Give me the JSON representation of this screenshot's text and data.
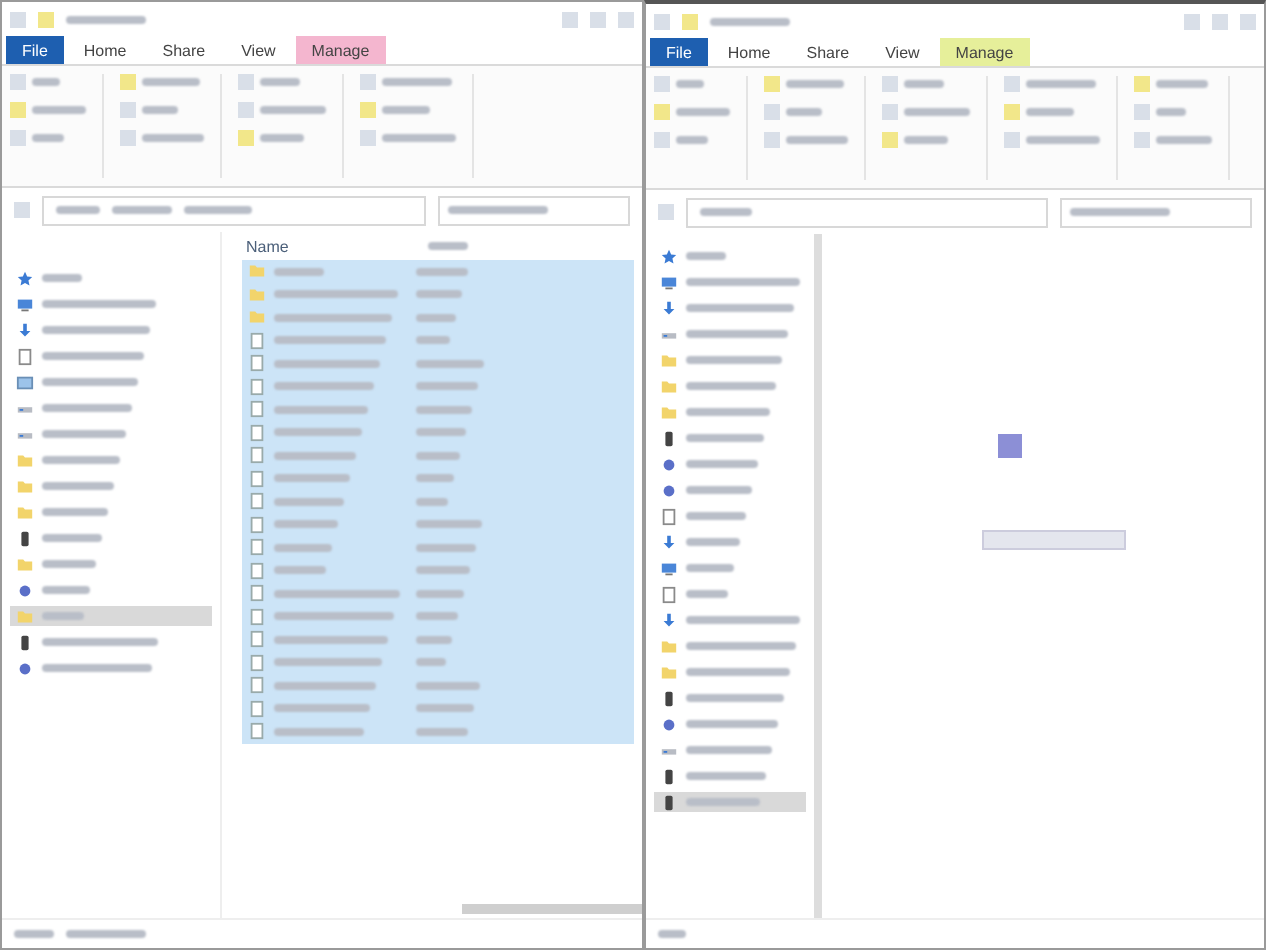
{
  "left_window": {
    "tabs": [
      {
        "label": "File",
        "kind": "file"
      },
      {
        "label": "Home",
        "kind": "tab"
      },
      {
        "label": "Share",
        "kind": "tab"
      },
      {
        "label": "View",
        "kind": "tab"
      },
      {
        "label": "Manage",
        "kind": "contextual",
        "color": "#f4b6cf"
      }
    ],
    "columns": [
      "Name"
    ],
    "nav_items": [
      {
        "kind": "star",
        "selected": false
      },
      {
        "kind": "desktop",
        "selected": false
      },
      {
        "kind": "download",
        "selected": false
      },
      {
        "kind": "doc",
        "selected": false
      },
      {
        "kind": "picture",
        "selected": false
      },
      {
        "kind": "drive",
        "selected": false
      },
      {
        "kind": "drive",
        "selected": false
      },
      {
        "kind": "folder",
        "selected": false
      },
      {
        "kind": "folder",
        "selected": false
      },
      {
        "kind": "folder",
        "selected": false
      },
      {
        "kind": "video",
        "selected": false
      },
      {
        "kind": "folder",
        "selected": false
      },
      {
        "kind": "network",
        "selected": false
      },
      {
        "kind": "folder",
        "selected": true
      },
      {
        "kind": "video",
        "selected": false
      },
      {
        "kind": "network",
        "selected": false
      }
    ],
    "files": [
      {
        "kind": "folder",
        "selected": true
      },
      {
        "kind": "folder",
        "selected": true
      },
      {
        "kind": "folder",
        "selected": true
      },
      {
        "kind": "file",
        "selected": true
      },
      {
        "kind": "file",
        "selected": true
      },
      {
        "kind": "file",
        "selected": true
      },
      {
        "kind": "file",
        "selected": true
      },
      {
        "kind": "file",
        "selected": true
      },
      {
        "kind": "file",
        "selected": true
      },
      {
        "kind": "file",
        "selected": true
      },
      {
        "kind": "file",
        "selected": true
      },
      {
        "kind": "file",
        "selected": true
      },
      {
        "kind": "file",
        "selected": true
      },
      {
        "kind": "file",
        "selected": true
      },
      {
        "kind": "file",
        "selected": true
      },
      {
        "kind": "file",
        "selected": true
      },
      {
        "kind": "file",
        "selected": true
      },
      {
        "kind": "file",
        "selected": true
      },
      {
        "kind": "file",
        "selected": true
      },
      {
        "kind": "file",
        "selected": true
      },
      {
        "kind": "file",
        "selected": true
      }
    ]
  },
  "right_window": {
    "tabs": [
      {
        "label": "File",
        "kind": "file"
      },
      {
        "label": "Home",
        "kind": "tab"
      },
      {
        "label": "Share",
        "kind": "tab"
      },
      {
        "label": "View",
        "kind": "tab"
      },
      {
        "label": "Manage",
        "kind": "contextual",
        "color": "#e6ef9a"
      }
    ],
    "nav_items": [
      {
        "kind": "star",
        "selected": false
      },
      {
        "kind": "desktop",
        "selected": false
      },
      {
        "kind": "download",
        "selected": false
      },
      {
        "kind": "drive",
        "selected": false
      },
      {
        "kind": "folder",
        "selected": false
      },
      {
        "kind": "folder",
        "selected": false
      },
      {
        "kind": "folder",
        "selected": false
      },
      {
        "kind": "video",
        "selected": false
      },
      {
        "kind": "network",
        "selected": false
      },
      {
        "kind": "network",
        "selected": false
      },
      {
        "kind": "doc",
        "selected": false
      },
      {
        "kind": "download",
        "selected": false
      },
      {
        "kind": "desktop",
        "selected": false
      },
      {
        "kind": "doc",
        "selected": false
      },
      {
        "kind": "download",
        "selected": false
      },
      {
        "kind": "folder",
        "selected": false
      },
      {
        "kind": "folder",
        "selected": false
      },
      {
        "kind": "video",
        "selected": false
      },
      {
        "kind": "network",
        "selected": false
      },
      {
        "kind": "drive",
        "selected": false
      },
      {
        "kind": "video",
        "selected": false
      },
      {
        "kind": "video",
        "selected": true
      }
    ]
  }
}
